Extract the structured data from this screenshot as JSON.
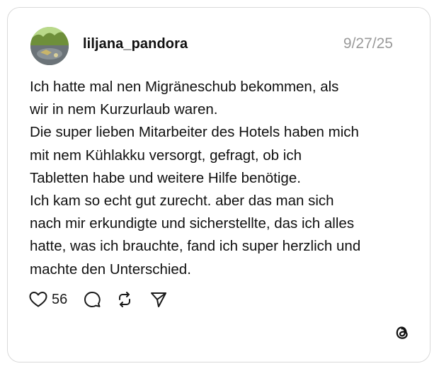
{
  "post": {
    "username": "liljana_pandora",
    "date": "9/27/25",
    "text": "Ich hatte mal nen Migräneschub bekommen, als\nwir in nem Kurzurlaub waren.\nDie super lieben Mitarbeiter des Hotels haben mich\nmit nem Kühlakku versorgt, gefragt, ob ich\nTabletten habe und weitere Hilfe benötige.\nIch kam so echt gut zurecht. aber das man sich\nnach mir erkundigte und sicherstellte, das ich alles\nhatte, was ich brauchte, fand ich super herzlich und\nmachte den Unterschied."
  },
  "actions": {
    "like_count": "56",
    "icons": [
      "heart-icon",
      "comment-icon",
      "repost-icon",
      "share-icon"
    ]
  },
  "branding": {
    "logo": "threads-logo-icon"
  },
  "colors": {
    "date": "#9a9a9a",
    "border": "#d9d9d9",
    "text": "#101010"
  }
}
